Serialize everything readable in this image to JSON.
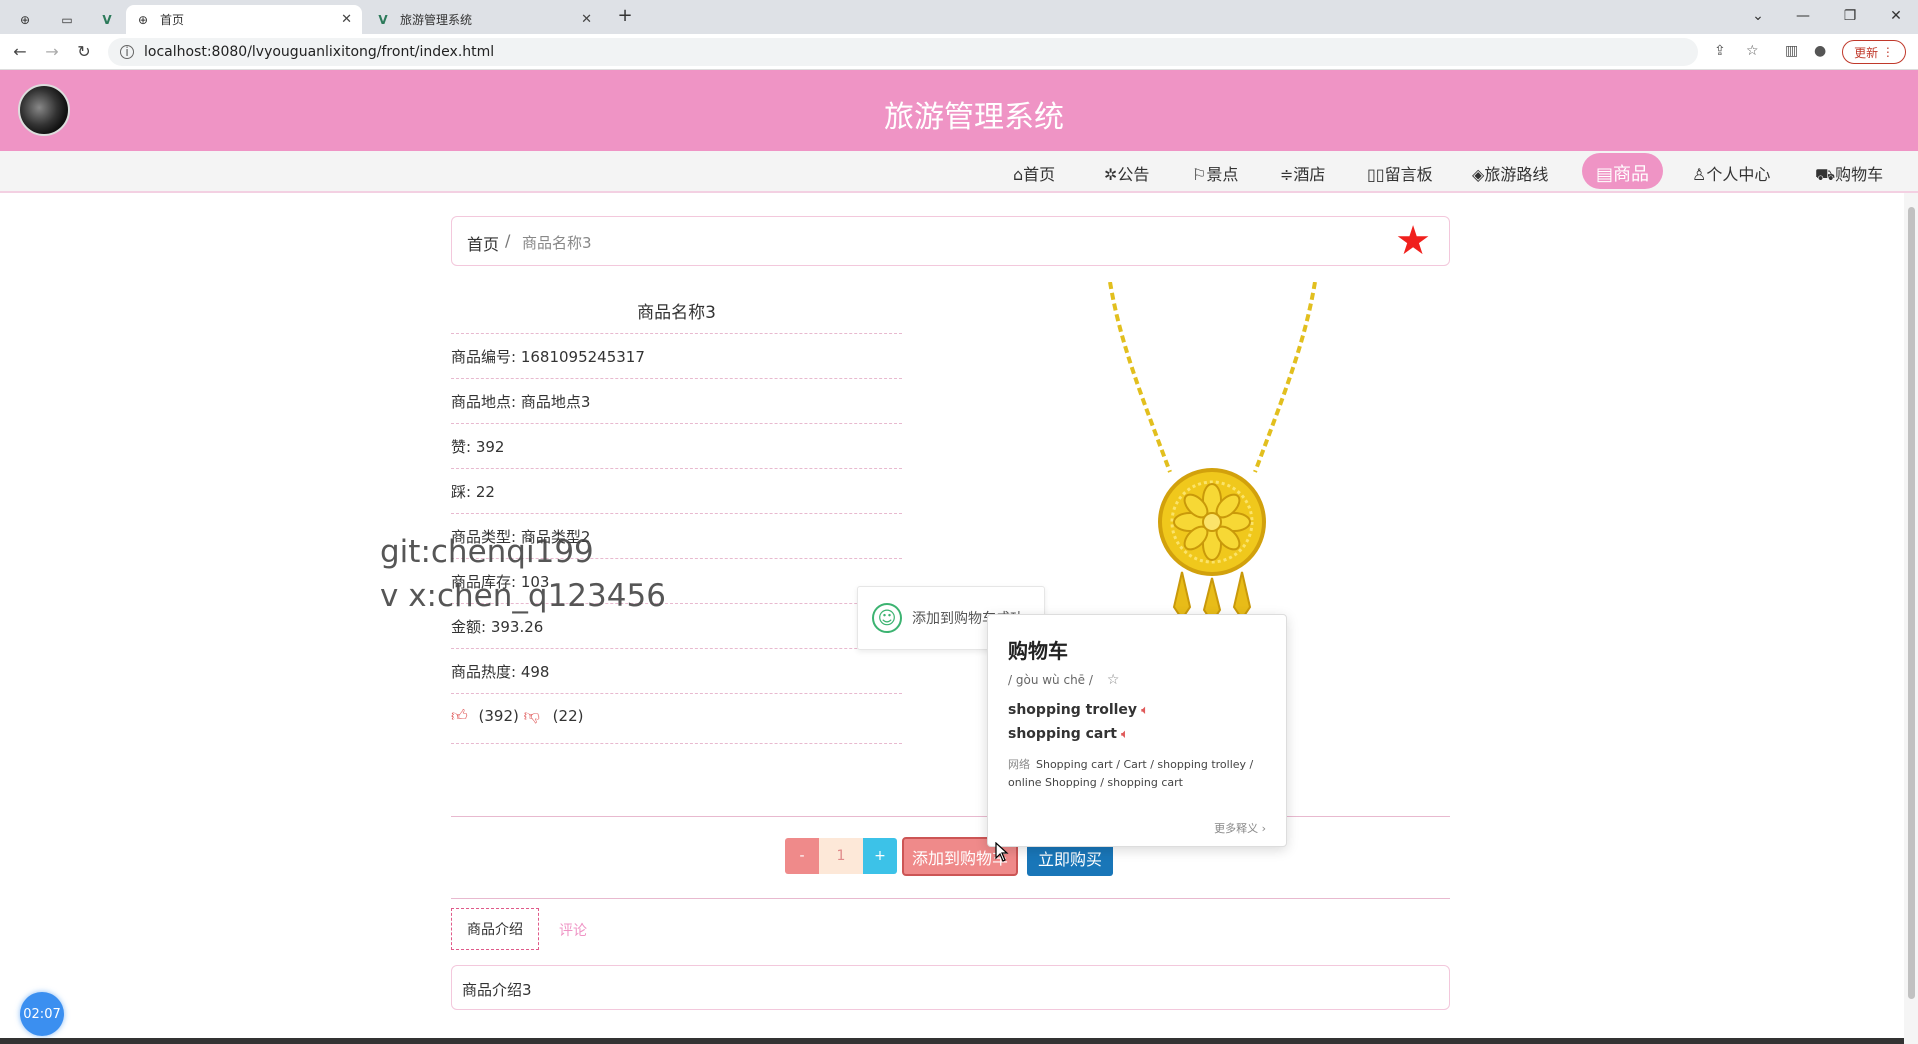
{
  "browser": {
    "tabs": [
      {
        "title": "首页"
      },
      {
        "title": "旅游管理系统"
      }
    ],
    "url": "localhost:8080/lvyouguanlixitong/front/index.html",
    "update_label": "更新"
  },
  "site": {
    "title": "旅游管理系统",
    "nav": [
      "首页",
      "公告",
      "景点",
      "酒店",
      "留言板",
      "旅游路线",
      "商品",
      "个人中心",
      "购物车"
    ]
  },
  "breadcrumb": {
    "home": "首页",
    "sep": "/",
    "current": "商品名称3"
  },
  "product": {
    "name": "商品名称3",
    "rows": [
      "商品编号: 1681095245317",
      "商品地点: 商品地点3",
      "赞: 392",
      "踩: 22",
      "商品类型: 商品类型2",
      "商品库存: 103",
      "金额: 393.26",
      "商品热度: 498"
    ],
    "likes": "(392)",
    "dislikes": "(22)",
    "quantity": "1",
    "minus": "-",
    "plus": "+",
    "add_to_cart": "添加到购物车",
    "buy_now": "立即购买"
  },
  "tabs": {
    "intro": "商品介绍",
    "comment": "评论"
  },
  "intro_text": "商品介绍3",
  "watermark": {
    "line1": "git:chenqi199",
    "line2": "v x:chen_q123456"
  },
  "toast": {
    "text": "添加到购物车成功"
  },
  "dict_popup": {
    "word": "购物车",
    "pinyin": "/ gòu wù chē /",
    "meaning1": "shopping trolley",
    "meaning2": "shopping cart",
    "net_label": "网络",
    "net_text": "Shopping cart / Cart / shopping trolley / online Shopping / shopping cart",
    "more": "更多释义 ›"
  },
  "timer": "02:07"
}
